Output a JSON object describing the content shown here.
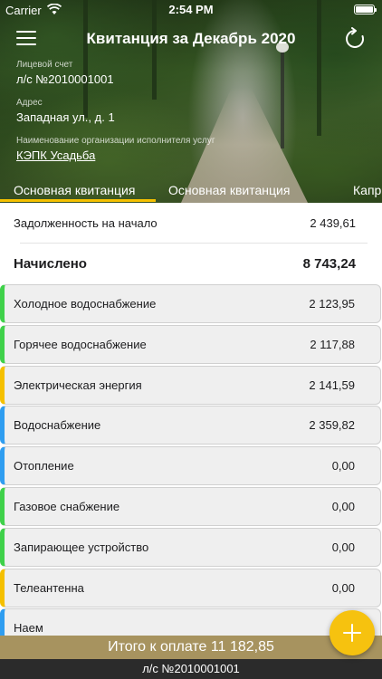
{
  "status_bar": {
    "carrier": "Carrier",
    "time": "2:54 PM"
  },
  "nav": {
    "title": "Квитанция за Декабрь 2020",
    "menu_icon": "hamburger-menu-icon",
    "refresh_icon": "refresh-icon"
  },
  "account": {
    "label": "Лицевой счет",
    "value": "л/с №2010001001",
    "address_label": "Адрес",
    "address": "Западная ул., д. 1",
    "org_label": "Наименование организации исполнителя услуг",
    "org": "КЭПК Усадьба"
  },
  "tabs": [
    {
      "label": "Основная квитанция",
      "selected": true
    },
    {
      "label": "Основная квитанция",
      "selected": false
    },
    {
      "label": "Капр",
      "selected": false
    }
  ],
  "accent_color": "#f5c000",
  "debt": {
    "label": "Задолженность на начало",
    "amount": "2 439,61"
  },
  "charged": {
    "label": "Начислено",
    "amount": "8 743,24"
  },
  "services": [
    {
      "label": "Холодное водоснабжение",
      "amount": "2 123,95",
      "color": "#3fd14a"
    },
    {
      "label": "Горячее водоснабжение",
      "amount": "2 117,88",
      "color": "#3fd14a"
    },
    {
      "label": "Электрическая энергия",
      "amount": "2 141,59",
      "color": "#f5c000"
    },
    {
      "label": "Водоснабжение",
      "amount": "2 359,82",
      "color": "#2f9df0"
    },
    {
      "label": "Отопление",
      "amount": "0,00",
      "color": "#2f9df0"
    },
    {
      "label": "Газовое снабжение",
      "amount": "0,00",
      "color": "#3fd14a"
    },
    {
      "label": "Запирающее устройство",
      "amount": "0,00",
      "color": "#3fd14a"
    },
    {
      "label": "Телеантенна",
      "amount": "0,00",
      "color": "#f5c000"
    },
    {
      "label": "Наем",
      "amount": "",
      "color": "#2f9df0"
    }
  ],
  "footer": {
    "total": "Итого к оплате 11 182,85",
    "account": "л/с №2010001001"
  },
  "fab_icon": "plus-icon"
}
